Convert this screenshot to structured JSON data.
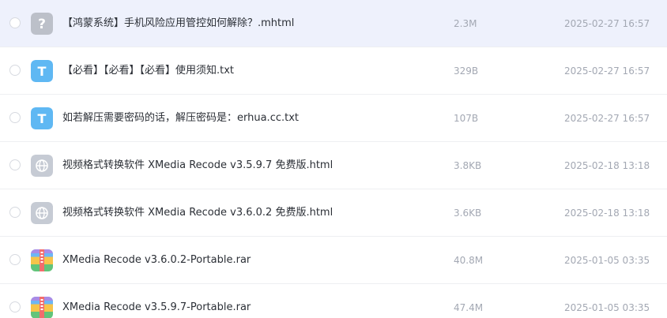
{
  "files": [
    {
      "name": "【鸿蒙系统】手机风险应用管控如何解除？.mhtml",
      "size": "2.3M",
      "date": "2025-02-27 16:57",
      "icon": "unknown-file-icon"
    },
    {
      "name": "【必看】【必看】【必看】使用须知.txt",
      "size": "329B",
      "date": "2025-02-27 16:57",
      "icon": "text-file-icon"
    },
    {
      "name": "如若解压需要密码的话，解压密码是：erhua.cc.txt",
      "size": "107B",
      "date": "2025-02-27 16:57",
      "icon": "text-file-icon"
    },
    {
      "name": "视频格式转换软件 XMedia Recode v3.5.9.7 免费版.html",
      "size": "3.8KB",
      "date": "2025-02-18 13:18",
      "icon": "web-file-icon"
    },
    {
      "name": "视频格式转换软件 XMedia Recode v3.6.0.2 免费版.html",
      "size": "3.6KB",
      "date": "2025-02-18 13:18",
      "icon": "web-file-icon"
    },
    {
      "name": "XMedia Recode v3.6.0.2-Portable.rar",
      "size": "40.8M",
      "date": "2025-01-05 03:35",
      "icon": "archive-file-icon"
    },
    {
      "name": "XMedia Recode v3.5.9.7-Portable.rar",
      "size": "47.4M",
      "date": "2025-01-05 03:35",
      "icon": "archive-file-icon"
    }
  ],
  "icon_glyphs": {
    "unknown": "?",
    "text": "T"
  },
  "colors": {
    "selected_row": "#eef1fc",
    "text_icon": "#5fb8f3",
    "unknown_icon": "#b9bdc6",
    "web_icon": "#c5cad3"
  }
}
